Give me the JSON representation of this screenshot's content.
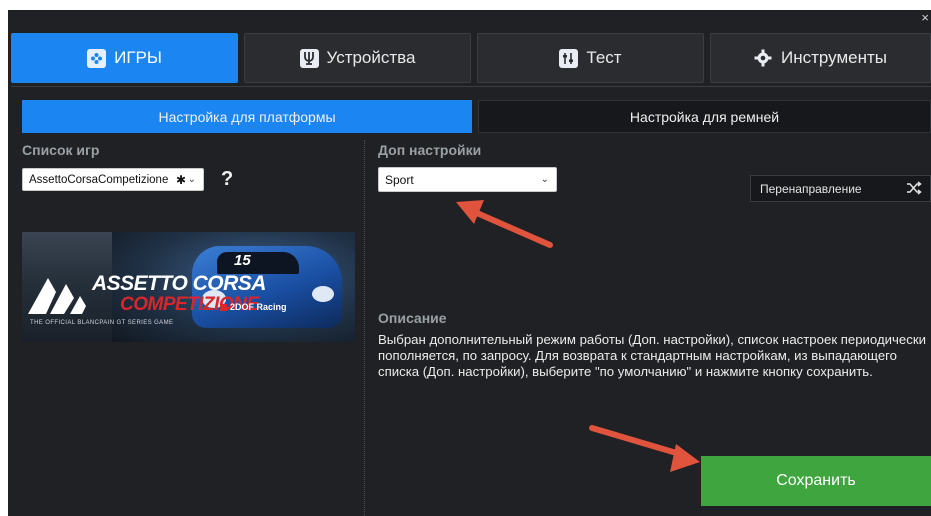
{
  "window": {
    "close_glyph": "×"
  },
  "main_tabs": [
    {
      "label": "ИГРЫ",
      "icon": "gamepad-icon",
      "active": true
    },
    {
      "label": "Устройства",
      "icon": "devices-icon",
      "active": false
    },
    {
      "label": "Тест",
      "icon": "sliders-icon",
      "active": false
    },
    {
      "label": "Инструменты",
      "icon": "gear-icon",
      "active": false
    }
  ],
  "sub_tabs": [
    {
      "label": "Настройка для платформы",
      "active": true
    },
    {
      "label": "Настройка для ремней",
      "active": false
    }
  ],
  "games": {
    "label": "Список игр",
    "selected": "AssettoCorsaCompetizione",
    "help": "?"
  },
  "banner": {
    "title_line1": "ASSETTO CORSA",
    "title_line2": "COMPETIZIONE",
    "subtitle": "THE OFFICIAL BLANCPAIN GT SERIES GAME",
    "car_number": "15",
    "sponsor": "2DOF Racing"
  },
  "extra": {
    "label": "Доп настройки",
    "selected": "Sport"
  },
  "redirect": {
    "label": "Перенаправление"
  },
  "description": {
    "title": "Описание",
    "text": "Выбран дополнительный режим работы (Доп. настройки), список настроек периодически пополняется, по запросу. Для возврата к стандартным настройкам, из выпадающего списка (Доп. настройки), выберите \"по умолчанию\" и нажмите кнопку сохранить."
  },
  "save_button": {
    "label": "Сохранить"
  },
  "colors": {
    "accent": "#1b86f2",
    "background": "#1f2124",
    "save": "#3fa63f",
    "annotation_arrow": "#e0533d"
  }
}
